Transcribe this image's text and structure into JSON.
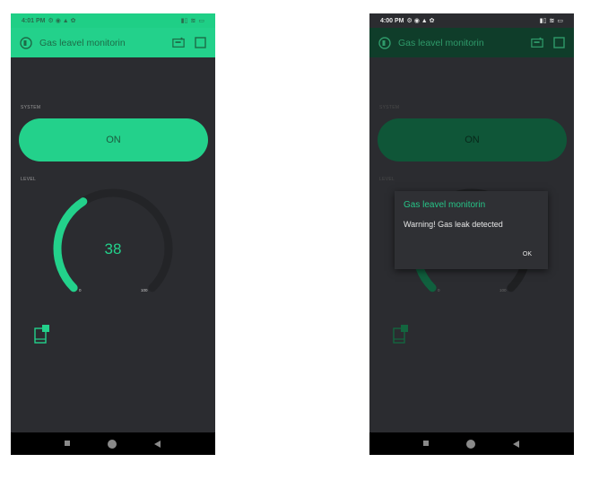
{
  "screen_a": {
    "status": {
      "time": "4:01 PM",
      "battery_icon": "battery-icon"
    },
    "app_title": "Gas leavel monitorin",
    "system_label": "SYSTEM",
    "switch_label": "ON",
    "level_label": "LEVEL",
    "gauge": {
      "value": 38,
      "value_text": "38",
      "min": 0,
      "max": 100,
      "min_text": "0",
      "max_text": "100",
      "accent": "#23d18b"
    }
  },
  "screen_b": {
    "status": {
      "time": "4:00 PM"
    },
    "app_title": "Gas leavel monitorin",
    "system_label": "SYSTEM",
    "switch_label": "ON",
    "level_label": "LEVEL",
    "gauge": {
      "min_text": "0",
      "max_text": "100"
    },
    "dialog": {
      "title": "Gas leavel monitorin",
      "message": "Warning! Gas leak detected",
      "ok_label": "OK"
    }
  },
  "colors": {
    "accent": "#23d18b",
    "background": "#2b2c30",
    "navbar": "#000000"
  }
}
